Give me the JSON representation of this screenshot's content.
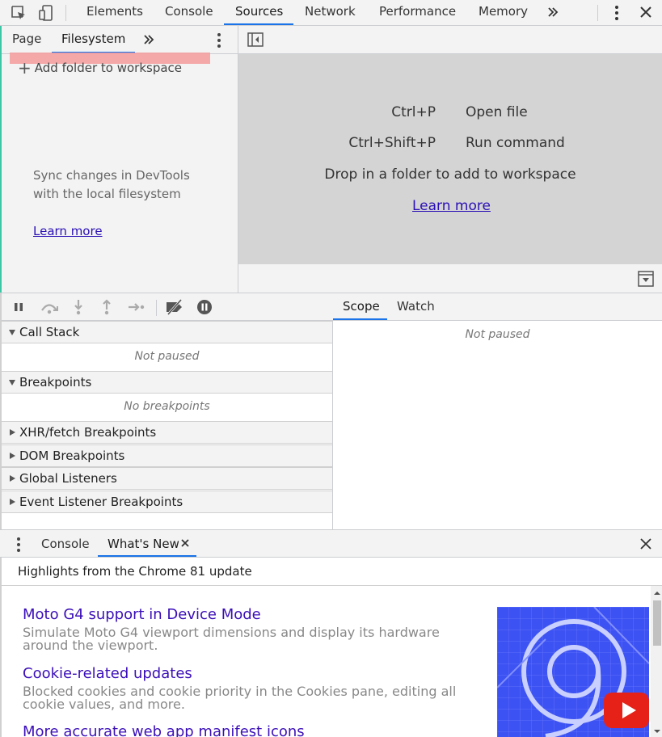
{
  "top_tabs": [
    {
      "label": "Elements"
    },
    {
      "label": "Console"
    },
    {
      "label": "Sources"
    },
    {
      "label": "Network"
    },
    {
      "label": "Performance"
    },
    {
      "label": "Memory"
    }
  ],
  "nav": {
    "tabs": [
      {
        "label": "Page"
      },
      {
        "label": "Filesystem"
      }
    ],
    "add_folder": "Add folder to workspace",
    "sync_text_1": "Sync changes in DevTools",
    "sync_text_2": "with the local filesystem",
    "learn_more": "Learn more"
  },
  "editor": {
    "shortcut1_key": "Ctrl+P",
    "shortcut1_label": "Open file",
    "shortcut2_key": "Ctrl+Shift+P",
    "shortcut2_label": "Run command",
    "drop_text": "Drop in a folder to add to workspace",
    "learn_more": "Learn more"
  },
  "debugger": {
    "sections": [
      {
        "label": "Call Stack",
        "expanded": true,
        "note": "Not paused"
      },
      {
        "label": "Breakpoints",
        "expanded": true,
        "note": "No breakpoints"
      },
      {
        "label": "XHR/fetch Breakpoints",
        "expanded": false
      },
      {
        "label": "DOM Breakpoints",
        "expanded": false
      },
      {
        "label": "Global Listeners",
        "expanded": false
      },
      {
        "label": "Event Listener Breakpoints",
        "expanded": false
      }
    ],
    "scope_tabs": [
      {
        "label": "Scope"
      },
      {
        "label": "Watch"
      }
    ],
    "scope_note": "Not paused"
  },
  "drawer": {
    "tabs": [
      {
        "label": "Console"
      },
      {
        "label": "What's New"
      }
    ],
    "highlights": "Highlights from the Chrome 81 update",
    "news": [
      {
        "title": "Moto G4 support in Device Mode",
        "desc": "Simulate Moto G4 viewport dimensions and display its hardware around the viewport."
      },
      {
        "title": "Cookie-related updates",
        "desc": "Blocked cookies and cookie priority in the Cookies pane, editing all cookie values, and more."
      },
      {
        "title": "More accurate web app manifest icons",
        "desc": ""
      }
    ]
  },
  "colors": {
    "accent": "#1a73e8",
    "link": "#2b0fb5",
    "highlight": "#f4a0a0"
  }
}
